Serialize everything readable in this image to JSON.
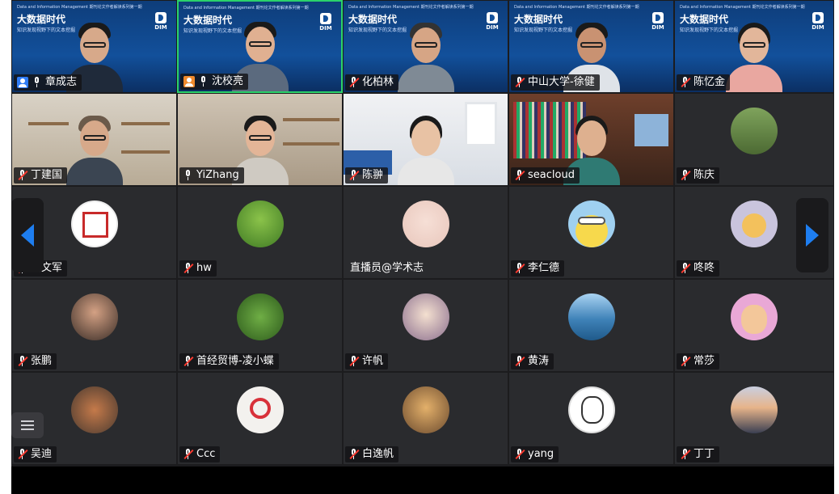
{
  "banner": {
    "top_text": "Data and Information Management 期刊论文作者解读系列第一期",
    "title": "大数据时代",
    "subtitle": "知识发现视野下的文本挖掘",
    "logo_text": "DIM"
  },
  "colors": {
    "active_speaker_border": "#2bd26b",
    "nav_arrow": "#1e7ef0",
    "host_badge": "#2f7cf6",
    "cohost_badge": "#f08a2c",
    "muted_slash": "#ff3b30"
  },
  "participants": [
    {
      "name": "章成志",
      "role": "host",
      "muted": false
    },
    {
      "name": "沈校亮",
      "role": "cohost",
      "muted": false,
      "active": true
    },
    {
      "name": "化柏林",
      "muted": true
    },
    {
      "name": "中山大学-徐健",
      "muted": true
    },
    {
      "name": "陈忆金",
      "muted": true
    },
    {
      "name": "丁建国",
      "muted": true
    },
    {
      "name": "YiZhang",
      "muted": false
    },
    {
      "name": "陈翀",
      "muted": true
    },
    {
      "name": "seacloud",
      "muted": true
    },
    {
      "name": "陈庆",
      "muted": true
    },
    {
      "name": "贾文军",
      "muted": true
    },
    {
      "name": "hw",
      "muted": true
    },
    {
      "name": "直播员@学术志",
      "muted": false
    },
    {
      "name": "李仁德",
      "muted": true
    },
    {
      "name": "咚咚",
      "muted": true
    },
    {
      "name": "张鹏",
      "muted": true
    },
    {
      "name": "首经贸博-凌小蝶",
      "muted": true
    },
    {
      "name": "许帆",
      "muted": true
    },
    {
      "name": "黄涛",
      "muted": true
    },
    {
      "name": "常莎",
      "muted": true
    },
    {
      "name": "吴迪",
      "muted": true
    },
    {
      "name": "Ccc",
      "muted": true
    },
    {
      "name": "白逸帆",
      "muted": true
    },
    {
      "name": "yang",
      "muted": true
    },
    {
      "name": "丁丁",
      "muted": true
    }
  ]
}
